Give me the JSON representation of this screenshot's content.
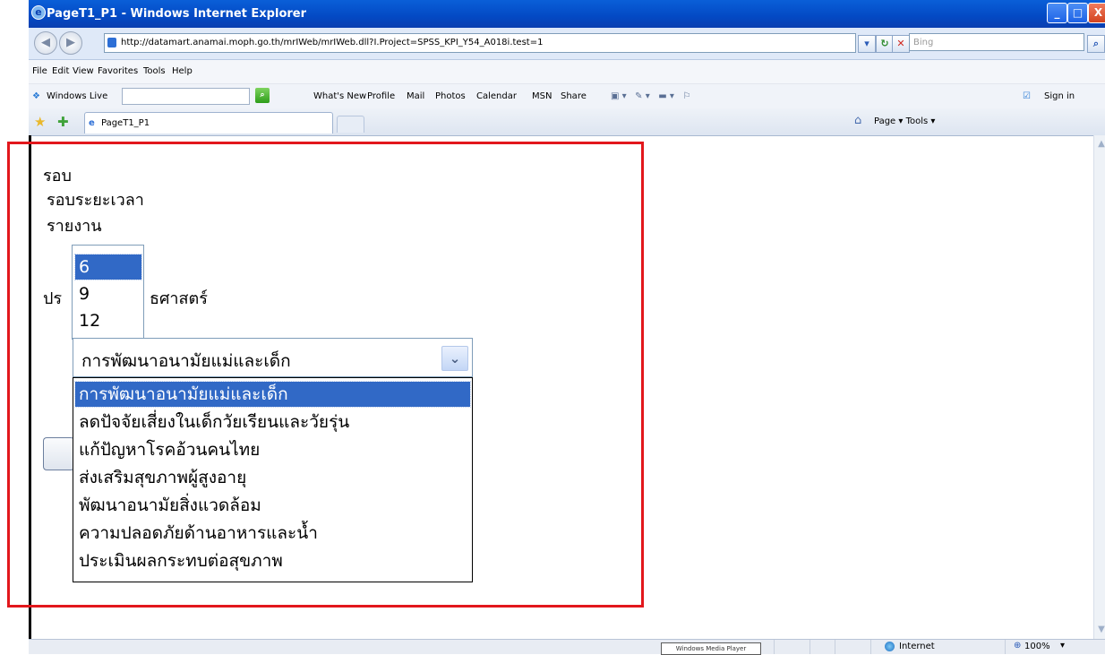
{
  "window": {
    "title": "PageT1_P1 - Windows Internet Explorer",
    "minimize": "_",
    "maximize": "□",
    "close": "X"
  },
  "address": {
    "url": "http://datamart.anamai.moph.go.th/mrIWeb/mrIWeb.dll?I.Project=SPSS_KPI_Y54_A018i.test=1",
    "search_placeholder": "Bing"
  },
  "menu": [
    "File",
    "Edit",
    "View",
    "Favorites",
    "Tools",
    "Help"
  ],
  "links": {
    "windows_live": "Windows Live",
    "items": [
      "What's New",
      "Profile",
      "Mail",
      "Photos",
      "Calendar",
      "MSN",
      "Share"
    ],
    "sign_in": "Sign in"
  },
  "tabs": {
    "active": "PageT1_P1"
  },
  "command_bar": "Page ▾  Tools ▾",
  "form": {
    "label_round": "รอบ",
    "label_period": "รอบระยะเวลา",
    "label_report": "รายงาน",
    "label_strategy_prefix": "ปร",
    "label_strategy_suffix": "ธศาสตร์",
    "period_options": [
      {
        "label": "6",
        "selected": true
      },
      {
        "label": "9",
        "selected": false
      },
      {
        "label": "12",
        "selected": false
      }
    ],
    "selected_program": "การพัฒนาอนามัยแม่และเด็ก",
    "program_options": [
      {
        "label": "การพัฒนาอนามัยแม่และเด็ก",
        "selected": true
      },
      {
        "label": "ลดปัจจัยเสี่ยงในเด็กวัยเรียนและวัยรุ่น",
        "selected": false
      },
      {
        "label": "แก้ปัญหาโรคอ้วนคนไทย",
        "selected": false
      },
      {
        "label": "ส่งเสริมสุขภาพผู้สูงอายุ",
        "selected": false
      },
      {
        "label": "พัฒนาอนามัยสิ่งแวดล้อม",
        "selected": false
      },
      {
        "label": "ความปลอดภัยด้านอาหารและน้ำ",
        "selected": false
      },
      {
        "label": "ประเมินผลกระทบต่อสุขภาพ",
        "selected": false
      }
    ]
  },
  "status": {
    "media_player": "Windows Media Player",
    "zone": "Internet",
    "zoom": "100%"
  },
  "colors": {
    "highlight": "#3169c6",
    "annotation_box": "#e2171c",
    "title_bar": "#0349c4"
  }
}
